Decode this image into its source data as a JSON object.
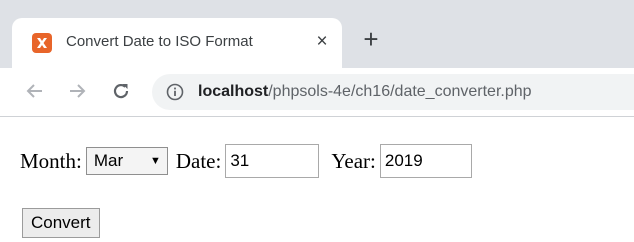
{
  "browser": {
    "tab": {
      "title": "Convert Date to ISO Format",
      "close_label": "×",
      "favicon": "xampp-icon"
    },
    "new_tab_label": "+",
    "address": {
      "host": "localhost",
      "path": "/phpsols-4e/ch16/date_converter.php"
    },
    "icons": {
      "back": "back-arrow-icon",
      "forward": "forward-arrow-icon",
      "reload": "reload-icon",
      "info": "info-icon"
    }
  },
  "form": {
    "month_label": "Month:",
    "month_value": "Mar",
    "date_label": "Date:",
    "date_value": "31",
    "year_label": "Year:",
    "year_value": "2019",
    "submit_label": "Convert"
  },
  "colors": {
    "tabstrip": "#dee1e6",
    "omnibox": "#f1f3f4",
    "favicon": "#e8652a"
  }
}
